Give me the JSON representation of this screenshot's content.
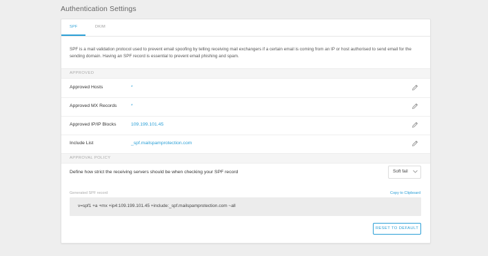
{
  "page": {
    "title": "Authentication Settings"
  },
  "tabs": [
    {
      "label": "SPF",
      "active": true
    },
    {
      "label": "DKIM",
      "active": false
    }
  ],
  "description": "SPF is a mail validation protocol used to prevent email spoofing by telling receiving mail exchangers if a certain email is coming from an IP or host authorised to send email for the sending domain. Having an SPF record is essential to prevent email phishing and spam.",
  "approved": {
    "header": "APPROVED",
    "rows": [
      {
        "label": "Approved Hosts",
        "value": "*",
        "icon": "pencil-icon"
      },
      {
        "label": "Approved MX Records",
        "value": "*",
        "icon": "pencil-icon"
      },
      {
        "label": "Approved IP/IP Blocks",
        "value": "109.199.101.45",
        "icon": "pencil-icon"
      },
      {
        "label": "Include List",
        "value": "_spf.mailspamprotection.com",
        "icon": "pencil-icon"
      }
    ]
  },
  "policy": {
    "header": "APPROVAL POLICY",
    "question": "Define how strict the receiving servers should be when checking your SPF record",
    "selected": "Soft fail"
  },
  "generated": {
    "label": "Generated SPF record",
    "copy_label": "Copy to Clipboard",
    "record": "v=spf1 +a +mx +ip4:109.199.101.45 +include:_spf.mailspamprotection.com ~all"
  },
  "actions": {
    "reset_label": "RESET TO DEFAULT"
  },
  "colors": {
    "accent": "#2a9fd6",
    "background": "#eeeeee"
  }
}
